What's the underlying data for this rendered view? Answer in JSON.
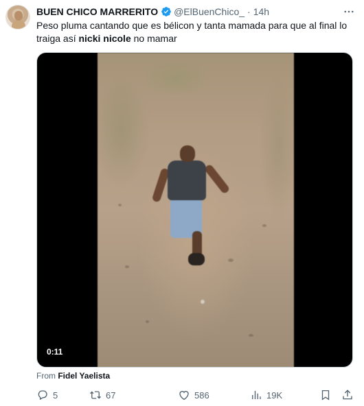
{
  "tweet": {
    "author": {
      "display_name": "BUEN CHICO MARRERITO",
      "handle": "@ElBuenChico_",
      "verified": true
    },
    "separator": "·",
    "timestamp": "14h",
    "text": {
      "part1": "Peso pluma cantando que es bélicon y tanta mamada para que al final lo traiga así ",
      "bold": "nicki nicole",
      "part2": " no mamar"
    },
    "media": {
      "type": "video",
      "duration": "0:11"
    },
    "attribution": {
      "prefix": "From",
      "source": "Fidel Yaelista"
    },
    "actions": {
      "replies": "5",
      "retweets": "67",
      "likes": "586",
      "views": "19K"
    },
    "icons": {
      "verified": "verified-badge-icon",
      "more": "more-icon",
      "reply": "reply-icon",
      "retweet": "retweet-icon",
      "like": "heart-icon",
      "views": "views-icon",
      "bookmark": "bookmark-icon",
      "share": "share-icon"
    },
    "colors": {
      "text_primary": "#0f1419",
      "text_secondary": "#536471",
      "verified_blue": "#1d9bf0"
    }
  }
}
